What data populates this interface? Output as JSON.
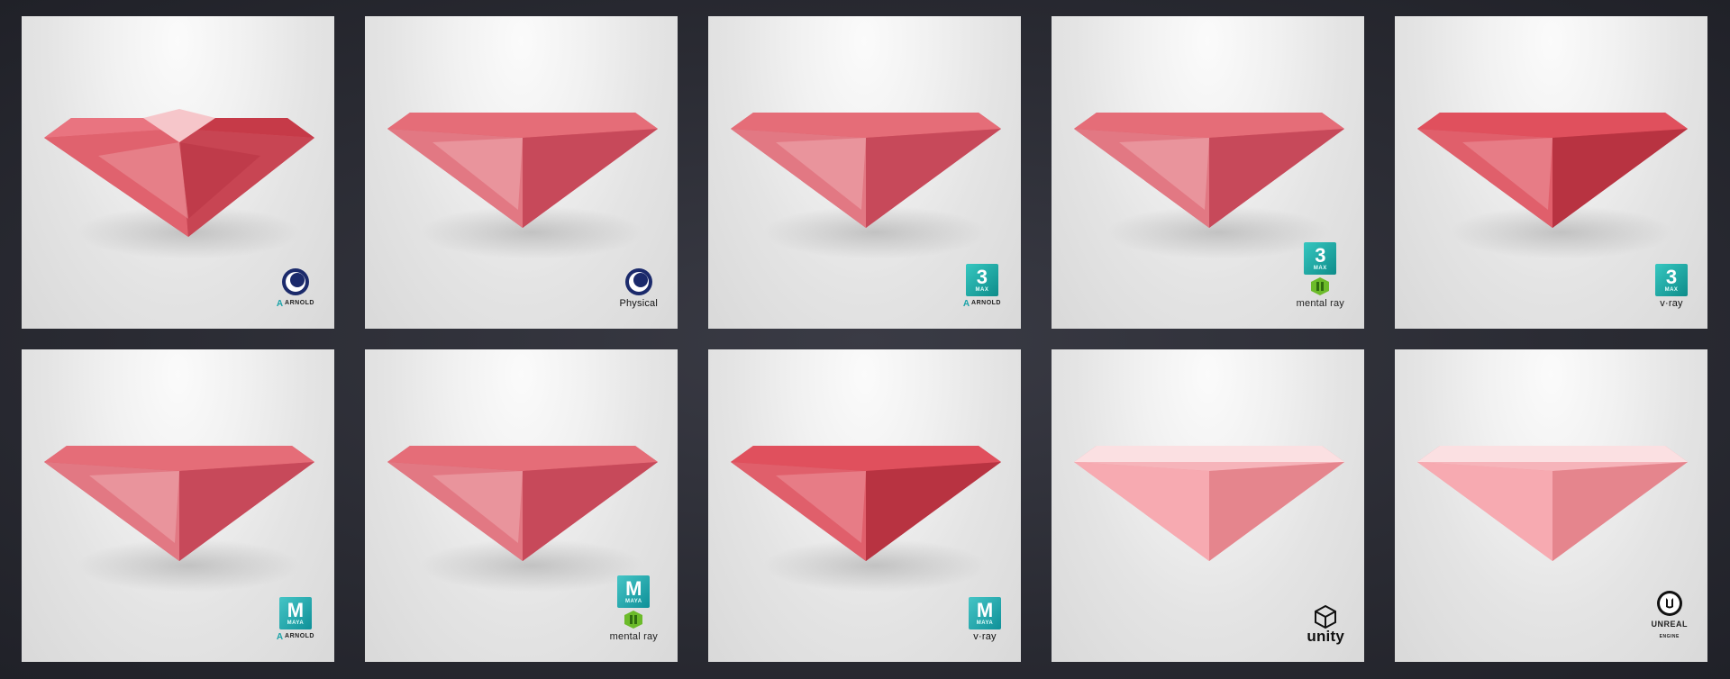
{
  "tiles": [
    {
      "id": "c4d-arnold",
      "labels": [
        "ARNOLD"
      ],
      "icons": [
        "cinema4d-icon",
        "arnold-icon"
      ]
    },
    {
      "id": "c4d-physical",
      "labels": [
        "Physical"
      ],
      "icons": [
        "cinema4d-icon"
      ]
    },
    {
      "id": "max-arnold",
      "badge": "3",
      "badge_sub": "MAX",
      "labels": [
        "ARNOLD"
      ],
      "icons": [
        "3dsmax-icon",
        "arnold-icon"
      ]
    },
    {
      "id": "max-mentalray",
      "badge": "3",
      "badge_sub": "MAX",
      "labels": [
        "mental ray"
      ],
      "icons": [
        "3dsmax-icon",
        "mentalray-icon"
      ]
    },
    {
      "id": "max-vray",
      "badge": "3",
      "badge_sub": "MAX",
      "labels": [
        "v·ray"
      ],
      "icons": [
        "3dsmax-icon",
        "vray-icon"
      ]
    },
    {
      "id": "maya-arnold",
      "badge": "M",
      "badge_sub": "MAYA",
      "labels": [
        "ARNOLD"
      ],
      "icons": [
        "maya-icon",
        "arnold-icon"
      ]
    },
    {
      "id": "maya-mentalray",
      "badge": "M",
      "badge_sub": "MAYA",
      "labels": [
        "mental ray"
      ],
      "icons": [
        "maya-icon",
        "mentalray-icon"
      ]
    },
    {
      "id": "maya-vray",
      "badge": "M",
      "badge_sub": "MAYA",
      "labels": [
        "v·ray"
      ],
      "icons": [
        "maya-icon",
        "vray-icon"
      ]
    },
    {
      "id": "unity",
      "labels": [
        "unity"
      ],
      "icons": [
        "unity-icon"
      ]
    },
    {
      "id": "unreal",
      "labels": [
        "UNREAL",
        "ENGINE"
      ],
      "icons": [
        "unreal-icon"
      ]
    }
  ],
  "colors": {
    "background": "#2a2b33",
    "tile": "#e8e8e8",
    "gem_dark": "#b8323f",
    "gem_mid": "#e0505d",
    "gem_light": "#f4a3aa",
    "gem_soft": "#f6a0a6",
    "max_teal": "#1ea7a3",
    "maya_teal": "#1aa0a6"
  }
}
